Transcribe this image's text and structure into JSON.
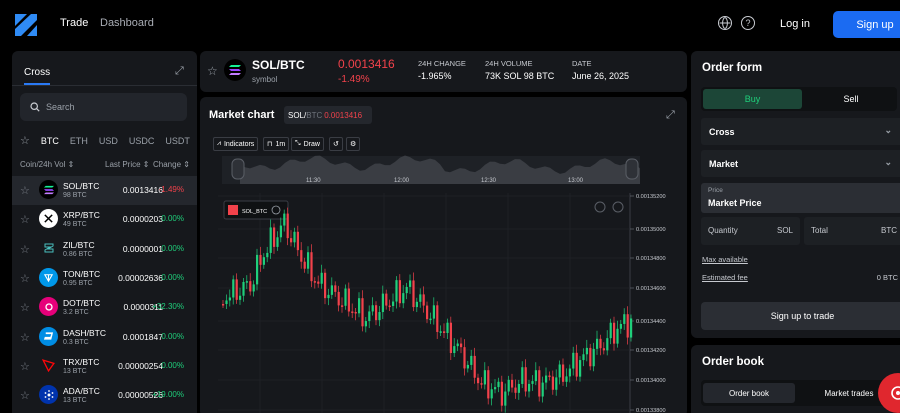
{
  "nav": {
    "trade": "Trade",
    "dashboard": "Dashboard",
    "help": "?",
    "login": "Log in",
    "signup": "Sign up"
  },
  "left": {
    "tab": "Cross",
    "search_placeholder": "Search",
    "filters": [
      "BTC",
      "ETH",
      "USD",
      "USDC",
      "USDT",
      "›"
    ],
    "headers": {
      "coin": "Coin/24h Vol ⇕",
      "price": "Last Price ⇕",
      "change": "Change ⇕"
    },
    "rows": [
      {
        "symbol": "SOL/BTC",
        "vol": "98 BTC",
        "price": "0.0013416",
        "change": "-1.49%",
        "dir": "down",
        "icon": "sol-icon",
        "icon_bg": "#000000"
      },
      {
        "symbol": "XRP/BTC",
        "vol": "49 BTC",
        "price": "0.0000203",
        "change": "0.00%",
        "dir": "up",
        "icon": "xrp-icon",
        "icon_bg": "#ffffff"
      },
      {
        "symbol": "ZIL/BTC",
        "vol": "0.86 BTC",
        "price": "0.0000001",
        "change": "0.00%",
        "dir": "up",
        "icon": "zil-icon",
        "icon_bg": "#16181c"
      },
      {
        "symbol": "TON/BTC",
        "vol": "0.95 BTC",
        "price": "0.00002636",
        "change": "0.00%",
        "dir": "up",
        "icon": "ton-icon",
        "icon_bg": "#0098ea"
      },
      {
        "symbol": "DOT/BTC",
        "vol": "3.2 BTC",
        "price": "0.0000311",
        "change": "+32.30%",
        "dir": "up",
        "icon": "dot-icon",
        "icon_bg": "#e6007a"
      },
      {
        "symbol": "DASH/BTC",
        "vol": "0.3 BTC",
        "price": "0.0001847",
        "change": "0.00%",
        "dir": "up",
        "icon": "dash-icon",
        "icon_bg": "#008de4"
      },
      {
        "symbol": "TRX/BTC",
        "vol": "13 BTC",
        "price": "0.00000254",
        "change": "0.00%",
        "dir": "up",
        "icon": "trx-icon",
        "icon_bg": "#16181c"
      },
      {
        "symbol": "ADA/BTC",
        "vol": "13 BTC",
        "price": "0.00000526",
        "change": "+19.00%",
        "dir": "up",
        "icon": "ada-icon",
        "icon_bg": "#0033ad"
      }
    ]
  },
  "ticker": {
    "pair": "SOL/BTC",
    "sub": "symbol",
    "price": "0.0013416",
    "change_pct": "-1.49%",
    "change_label": "24H CHANGE",
    "change_val": "-1.965%",
    "volume_label": "24H VOLUME",
    "volume_val": "73K SOL 98 BTC",
    "date_label": "DATE",
    "date_val": "June 26, 2025"
  },
  "chart": {
    "title": "Market chart",
    "pill_base": "SOL/",
    "pill_quote": "BTC",
    "pill_price": "0.0013416",
    "toolbar": {
      "indicators": "Indicators",
      "interval": "1m",
      "draw": "Draw"
    },
    "nav_times": [
      "11:30",
      "12:00",
      "12:30",
      "13:00"
    ],
    "legend": "SOL_BTC",
    "y_ticks": [
      "0.00135200",
      "0.00135000",
      "0.00134800",
      "0.00134600",
      "0.00134400",
      "0.00134200",
      "0.00134000",
      "0.00133800"
    ],
    "colors": {
      "up": "#1fcf7b",
      "down": "#f2424b",
      "grid": "#24272d"
    }
  },
  "order": {
    "title": "Order form",
    "buy": "Buy",
    "sell": "Sell",
    "margin_mode": "Cross",
    "order_type": "Market",
    "price_label": "Price",
    "price_value": "Market Price",
    "qty_label": "Quantity",
    "qty_unit": "SOL",
    "total_label": "Total",
    "total_unit": "BTC",
    "max_available": "Max available",
    "est_fee": "Estimated fee",
    "est_fee_val": "0 BTC",
    "cta": "Sign up to trade"
  },
  "book": {
    "title": "Order book",
    "tab1": "Order book",
    "tab2": "Market trades"
  }
}
